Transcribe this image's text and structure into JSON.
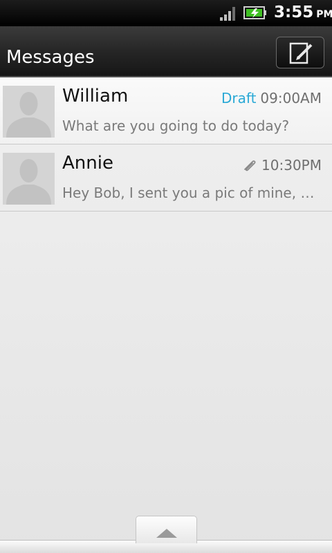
{
  "status_bar": {
    "time": "3:55",
    "ampm": "PM",
    "icons": [
      "signal-icon",
      "battery-charging-icon"
    ]
  },
  "header": {
    "title": "Messages",
    "compose_icon": "compose-icon"
  },
  "messages": [
    {
      "sender": "William",
      "draft_label": "Draft",
      "time": "09:00AM",
      "snippet": "What are you going to do today?"
    },
    {
      "sender": "Annie",
      "attachment_icon": "paperclip-icon",
      "time": "10:30PM",
      "snippet": "Hey Bob, I sent you a pic of mine, give ..."
    }
  ],
  "footer": {
    "expand_icon": "chevron-up-icon"
  },
  "colors": {
    "draft_accent": "#2aa9d6",
    "battery_green": "#3fbf22"
  }
}
